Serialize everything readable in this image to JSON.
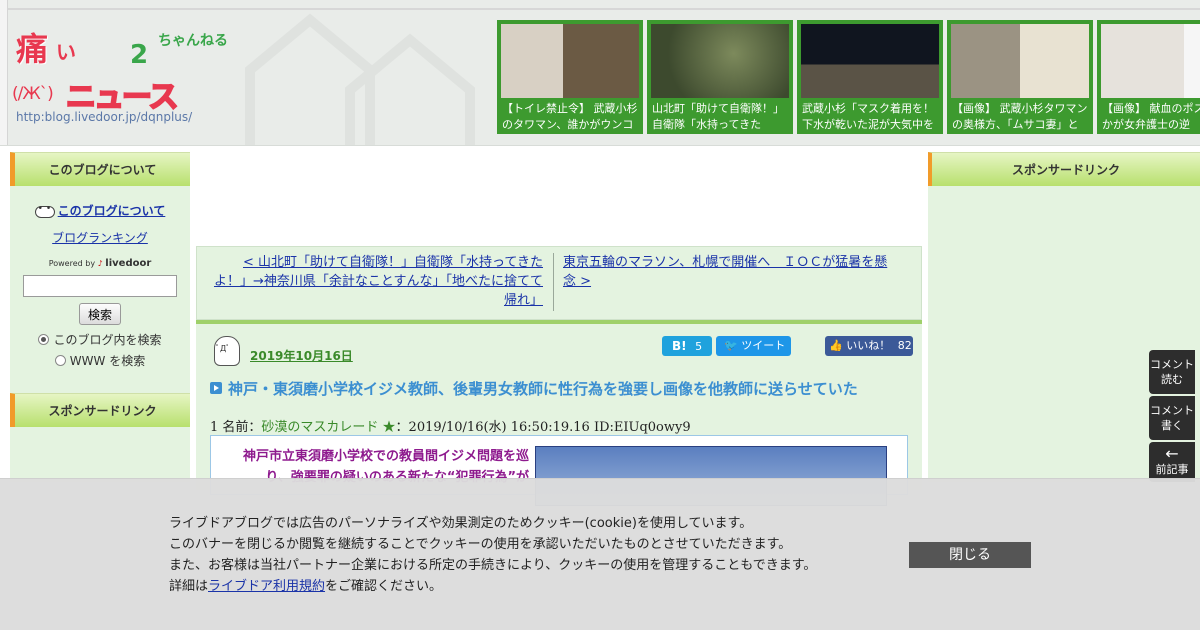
{
  "header": {
    "logo": {
      "char_ita": "痛",
      "char_i": "い",
      "char_two": "2",
      "char_chan": "ちゃんねる",
      "face": "(/Ж`)",
      "news": "ニュース",
      "url": "http:blog.livedoor.jp/dqnplus/"
    },
    "thumbs": [
      {
        "caption": "【トイレ禁止令】 武蔵小杉のタワマン、誰かがウンコし",
        "image_tone": "#8a7a64"
      },
      {
        "caption": "山北町「助けて自衛隊！」 自衛隊「水持ってきた",
        "image_tone": "#4a5a3a"
      },
      {
        "caption": "武蔵小杉「マスク着用を！下水が乾いた泥が大気中を",
        "image_tone": "#1b2230"
      },
      {
        "caption": "【画像】 武蔵小杉タワマンの奥様方、「ムサコ妻」と",
        "image_tone": "#8a8070"
      },
      {
        "caption": "【画像】 献血のポスター何かが女弁護士の逆",
        "image_tone": "#d8d4d0"
      }
    ]
  },
  "left_sidebar": {
    "about_header": "このブログについて",
    "about_link": "このブログについて",
    "ranking_link": "ブログランキング",
    "powered_label": "Powered by",
    "powered_brand": "livedoor",
    "search_button": "検索",
    "search_input_value": "",
    "radio_blog": "このブログ内を検索",
    "radio_www": "WWW を検索",
    "sponsor_header": "スポンサードリンク"
  },
  "nav": {
    "prev": "< 山北町「助けて自衛隊！」自衛隊「水持ってきたよ！」→神奈川県「余計なことすんな」「地べたに捨てて帰れ」",
    "next": "東京五輪のマラソン、札幌で開催へ　ＩＯＣが猛暑を懸念 >"
  },
  "article": {
    "date": "2019年10月16日",
    "hatebu_label": "B!",
    "hatebu_count": "5",
    "tweet_label": "ツイート",
    "like_label": "いいね！",
    "like_count": "82",
    "title": "神戸・東須磨小学校イジメ教師、後輩男女教師に性行為を強要し画像を他教師に送らせていた",
    "res_prefix": "1 名前：",
    "res_name": "砂漠のマスカレード ★",
    "res_meta": "：2019/10/16(水) 16:50:19.16 ID:EIUq0owy9",
    "quote": "神戸市立東須磨小学校での教員間イジメ問題を巡り、強要罪の疑いのある新たな“犯罪行為”が"
  },
  "right_sidebar": {
    "sponsor_header": "スポンサードリンク"
  },
  "float": {
    "read_l1": "コメント",
    "read_l2": "読む",
    "write_l1": "コメント",
    "write_l2": "書く",
    "prev_arrow": "🡐",
    "prev_label": "前記事"
  },
  "cookie": {
    "line1": "ライブドアブログでは広告のパーソナライズや効果測定のためクッキー(cookie)を使用しています。",
    "line2": "このバナーを閉じるか閲覧を継続することでクッキーの使用を承認いただいたものとさせていただきます。",
    "line3": "また、お客様は当社パートナー企業における所定の手続きにより、クッキーの使用を管理することもできます。",
    "line4_pre": "詳細は",
    "line4_link": "ライブドア利用規約",
    "line4_post": "をご確認ください。",
    "close": "閉じる"
  },
  "colors": {
    "accent_green": "#3d9a2f",
    "link_blue": "#1a33a8",
    "title_blue": "#3c8fd1",
    "quote_purple": "#8e1a8e",
    "hatebu": "#1fa2dd",
    "twitter": "#1e96e8",
    "facebook": "#3b5998"
  }
}
